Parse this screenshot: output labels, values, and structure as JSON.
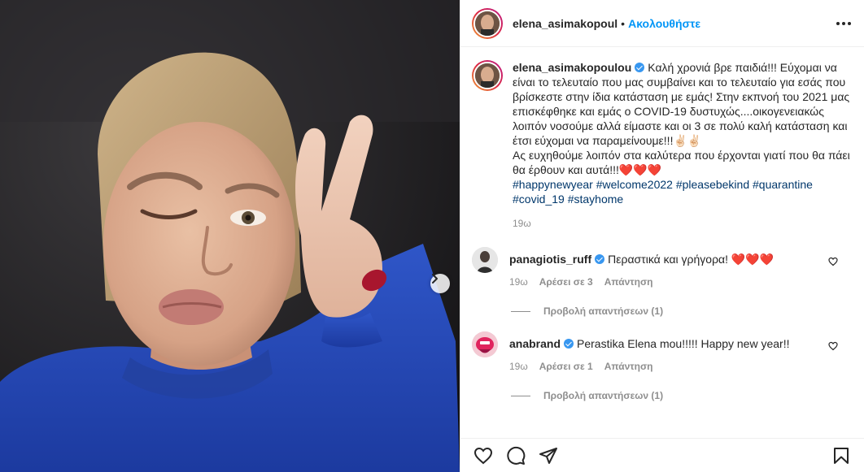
{
  "header": {
    "username": "elena_asimakopoul",
    "separator": "•",
    "follow_label": "Ακολουθήστε"
  },
  "caption": {
    "username": "elena_asimakopoulou",
    "text_1": "Καλή χρονιά βρε παιδιά!!! Εύχομαι να είναι το τελευταίο που μας συμβαίνει και το τελευταίο για εσάς που βρίσκεστε στην ίδια κατάσταση με εμάς! Στην εκπνοή του 2021 μας επισκέφθηκε και εμάς ο COVID-19 δυστυχώς....οικογενειακώς λοιπόν νοσούμε αλλά είμαστε και οι 3 σε πολύ καλή κατάσταση και έτσι εύχομαι να παραμείνουμε!!!✌🏻✌🏻",
    "text_2": "Ας ευχηθούμε λοιπόν στα καλύτερα που έρχονται γιατί που θα πάει θα έρθουν και αυτά!!!❤️❤️❤️",
    "hashtags": [
      "#happynewyear",
      "#welcome2022",
      "#pleasebekind",
      "#quarantine",
      "#covid_19",
      "#stayhome"
    ],
    "time": "19ω"
  },
  "comments": [
    {
      "username": "panagiotis_ruff",
      "text": "Περαστικά και γρήγορα! ❤️❤️❤️",
      "time": "19ω",
      "likes": "Αρέσει σε 3",
      "reply": "Απάντηση",
      "view_replies": "Προβολή απαντήσεων (1)"
    },
    {
      "username": "anabrand",
      "text": "Perastika Elena mou!!!!! Happy new year!!",
      "time": "19ω",
      "likes": "Αρέσει σε 1",
      "reply": "Απάντηση",
      "view_replies": "Προβολή απαντήσεων (1)"
    }
  ],
  "icons": {
    "more": "more-options-icon",
    "next": "chevron-right-icon",
    "like": "heart-icon",
    "comment": "comment-icon",
    "share": "paper-plane-icon",
    "save": "bookmark-icon"
  },
  "colors": {
    "accent": "#0095f6",
    "hashtag": "#00376b",
    "verified": "#3897f0",
    "muted": "#8e8e8e"
  }
}
